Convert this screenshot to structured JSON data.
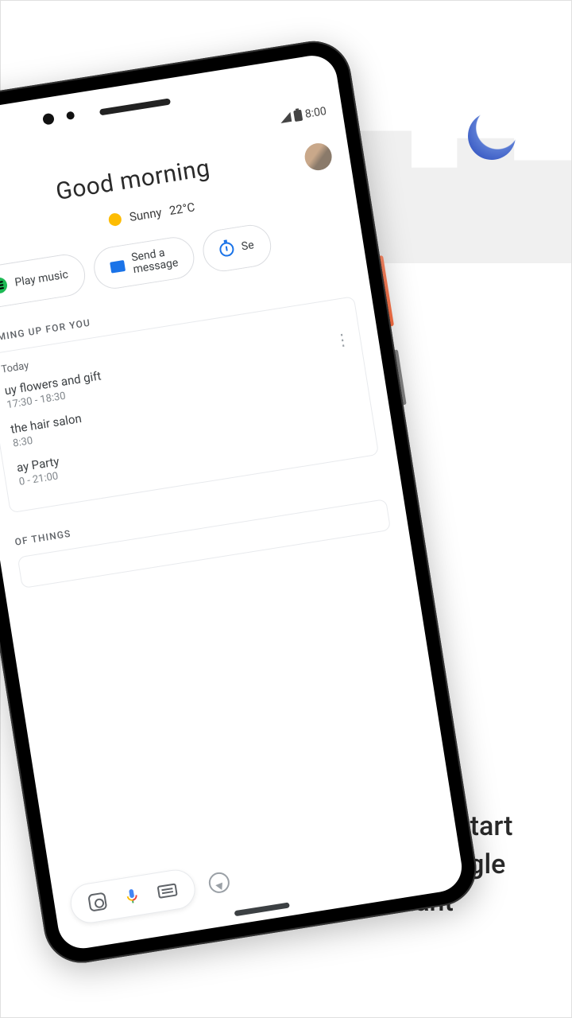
{
  "promo_text": "Get the app to start using your Google Assistant",
  "status": {
    "time": "8:00"
  },
  "greeting": "Good morning",
  "weather": {
    "condition": "Sunny",
    "temp": "22°C"
  },
  "chips": {
    "play_music": "Play music",
    "send_message_l1": "Send a",
    "send_message_l2": "message",
    "set_timer_partial": "Se"
  },
  "coming_up": {
    "header": "COMING UP FOR YOU",
    "day": "Today",
    "events": [
      {
        "title": "uy flowers and gift",
        "time": "17:30 - 18:30"
      },
      {
        "title": "the hair salon",
        "time": "8:30"
      },
      {
        "title": "ay Party",
        "time": "0 - 21:00"
      }
    ]
  },
  "things": {
    "header": "OF THINGS"
  }
}
